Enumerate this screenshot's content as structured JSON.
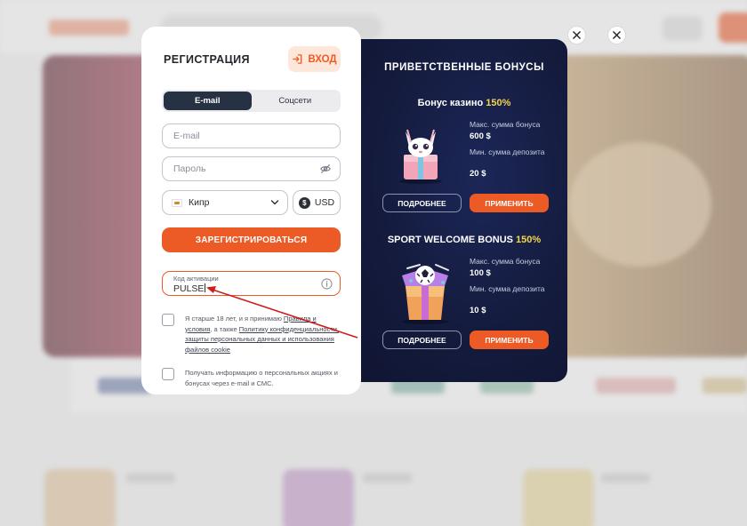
{
  "registration": {
    "title": "РЕГИСТРАЦИЯ",
    "login_label": "ВХОД",
    "tabs": [
      {
        "label": "E-mail",
        "active": true
      },
      {
        "label": "Соцсети",
        "active": false
      }
    ],
    "email_placeholder": "E-mail",
    "password_placeholder": "Пароль",
    "country": "Кипр",
    "currency_symbol": "$",
    "currency": "USD",
    "register_label": "ЗАРЕГИСТРИРОВАТЬСЯ",
    "promo_label": "Код активации",
    "promo_value": "PULSE",
    "consent": {
      "text_1": "Я старше 18 лет, и я принимаю ",
      "link_terms": "Правила и условия",
      "text_2": ", а также ",
      "link_privacy": "Политику конфиденциальности, защиты персональных данных и использования файлов cookie"
    },
    "newsletter_text": "Получать информацию о персональных акциях и бонусах через e-mail и СМС."
  },
  "bonuses": {
    "title": "ПРИВЕТСТВЕННЫЕ БОНУСЫ",
    "casino": {
      "heading": "Бонус казино ",
      "percent": "150%",
      "max_label": "Макс. сумма бонуса",
      "max_value": "600 $",
      "min_label": "Мин. сумма депозита",
      "min_value": "20 $",
      "more_label": "ПОДРОБНЕЕ",
      "apply_label": "ПРИМЕНИТЬ"
    },
    "sport": {
      "heading": "SPORT WELCOME BONUS ",
      "percent": "150%",
      "max_label": "Макс. сумма бонуса",
      "max_value": "100 $",
      "min_label": "Мин. сумма депозита",
      "min_value": "10 $",
      "more_label": "ПОДРОБНЕЕ",
      "apply_label": "ПРИМЕНИТЬ"
    }
  },
  "colors": {
    "accent": "#ec5a25",
    "bonus_bg": "#141b3d",
    "highlight": "#f6d64c",
    "tab_active": "#263144"
  },
  "icons": [
    "login-icon",
    "eye-off-icon",
    "flag-icon",
    "chevron-down-icon",
    "dollar-icon",
    "info-icon",
    "close-icon",
    "fox-gift-icon",
    "soccer-gift-icon"
  ]
}
